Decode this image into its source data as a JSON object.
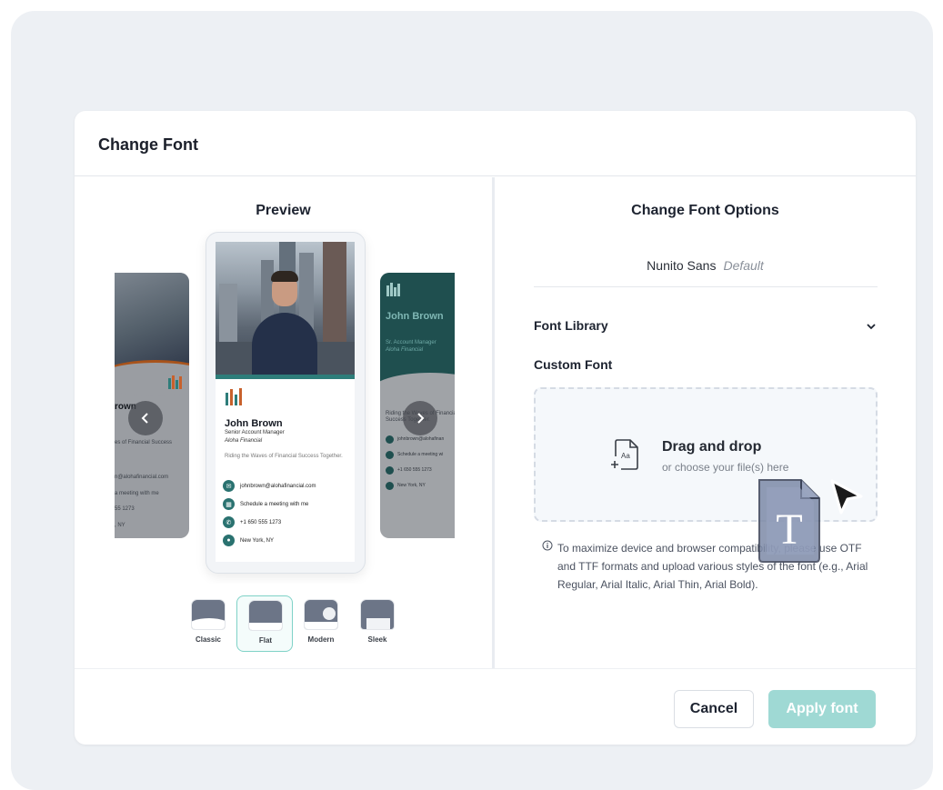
{
  "modal": {
    "title": "Change Font"
  },
  "preview": {
    "title": "Preview",
    "card": {
      "name": "John Brown",
      "role": "Senior Account Manager",
      "company": "Aloha Financial",
      "tagline": "Riding the Waves of Financial Success Together.",
      "contacts": [
        {
          "icon": "email-icon",
          "text": "johnbrown@alohafinancial.com"
        },
        {
          "icon": "calendar-icon",
          "text": "Schedule a meeting with me"
        },
        {
          "icon": "phone-icon",
          "text": "+1 650 555 1273"
        },
        {
          "icon": "location-icon",
          "text": "New York, NY"
        }
      ]
    },
    "left_card": {
      "name_fragment": "rown",
      "tag_fragment": "es of Financial Success",
      "email_fragment": "n@alohafinancial.com",
      "meeting_fragment": "a meeting with me",
      "phone_fragment": "55 1273",
      "location_fragment": ", NY"
    },
    "right_card": {
      "name": "John Brown",
      "role": "Sr. Account Manager",
      "company": "Aloha Financial",
      "tag": "Riding the Waves of Financial Success Together.",
      "email": "johnbrown@alohafinan",
      "meeting": "Schedule a meeting wi",
      "phone": "+1 650 555 1273",
      "location": "New York, NY"
    },
    "templates": [
      {
        "label": "Classic",
        "selected": false
      },
      {
        "label": "Flat",
        "selected": true
      },
      {
        "label": "Modern",
        "selected": false
      },
      {
        "label": "Sleek",
        "selected": false
      }
    ]
  },
  "options": {
    "title": "Change Font Options",
    "current_font": "Nunito Sans",
    "current_font_badge": "Default",
    "font_library_label": "Font Library",
    "custom_font_label": "Custom Font",
    "dropzone": {
      "title": "Drag and drop",
      "subtitle": "or choose your file(s) here"
    },
    "info": "To maximize device and browser compatibility, please use OTF and TTF formats and upload various styles of the font (e.g., Arial Regular, Arial Italic, Arial Thin, Arial Bold)."
  },
  "footer": {
    "cancel_label": "Cancel",
    "apply_label": "Apply font"
  },
  "colors": {
    "accent_teal": "#2e7d7a",
    "apply_disabled": "#9fd9d4",
    "backdrop": "#edf0f4"
  }
}
